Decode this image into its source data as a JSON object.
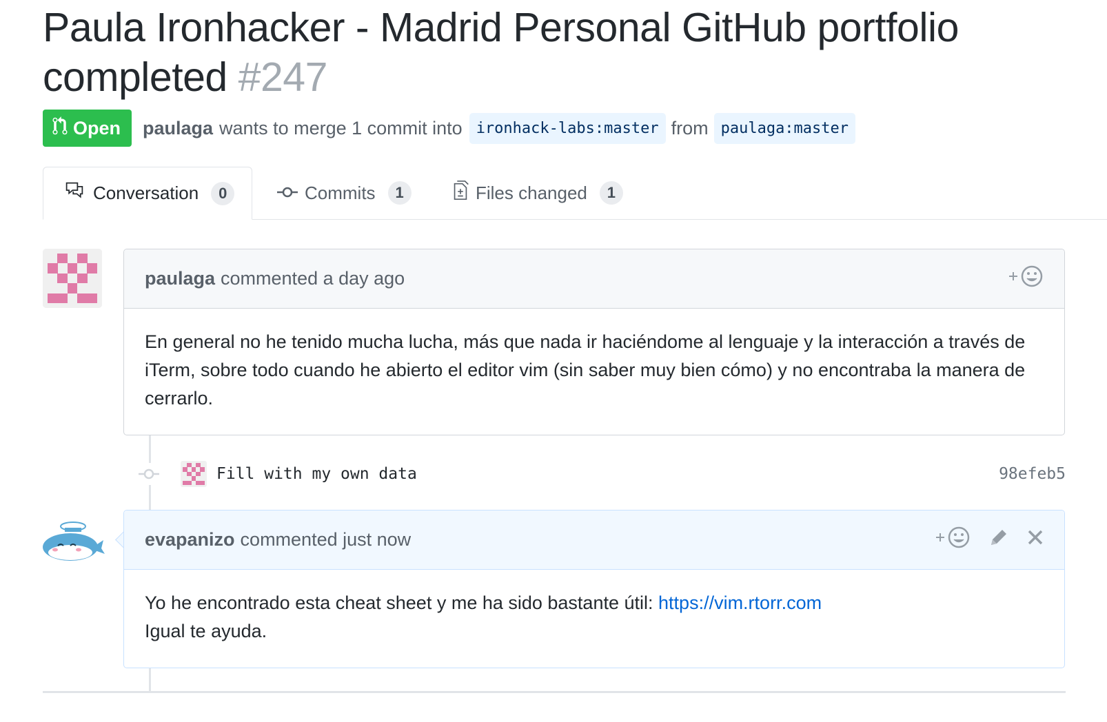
{
  "pull_request": {
    "title": "Paula Ironhacker - Madrid Personal GitHub portfolio completed",
    "number": "#247",
    "state_label": "Open",
    "state_color": "#2cbe4e",
    "author": "paulaga",
    "merge_text": "wants to merge 1 commit into",
    "base_branch": "ironhack-labs:master",
    "from_word": "from",
    "head_branch": "paulaga:master"
  },
  "tabs": [
    {
      "label": "Conversation",
      "count": "0",
      "icon": "comment-discussion-icon",
      "selected": true
    },
    {
      "label": "Commits",
      "count": "1",
      "icon": "git-commit-icon",
      "selected": false
    },
    {
      "label": "Files changed",
      "count": "1",
      "icon": "file-diff-icon",
      "selected": false
    }
  ],
  "timeline": {
    "comment1": {
      "author": "paulaga",
      "meta": "commented a day ago",
      "reaction_icon": "add-reaction-icon",
      "body": "En general no he tenido mucha lucha, más que nada ir haciéndome al lenguaje y la interacción a través de iTerm, sobre todo cuando he abierto el editor vim (sin saber muy bien cómo) y no encontraba la manera de cerrarlo."
    },
    "commit": {
      "message": "Fill with my own data",
      "sha": "98efeb5",
      "icon": "git-commit-icon"
    },
    "comment2": {
      "author": "evapanizo",
      "meta": "commented just now",
      "reaction_icon": "add-reaction-icon",
      "edit_icon": "pencil-icon",
      "delete_icon": "x-icon",
      "body_text": "Yo he encontrado esta cheat sheet y me ha sido bastante útil:",
      "link": "https://vim.rtorr.com",
      "body_line2": "Igual te ayuda."
    }
  },
  "colors": {
    "link": "#0366d6",
    "muted": "#586069",
    "identicon_pink": "#e07ba7"
  }
}
